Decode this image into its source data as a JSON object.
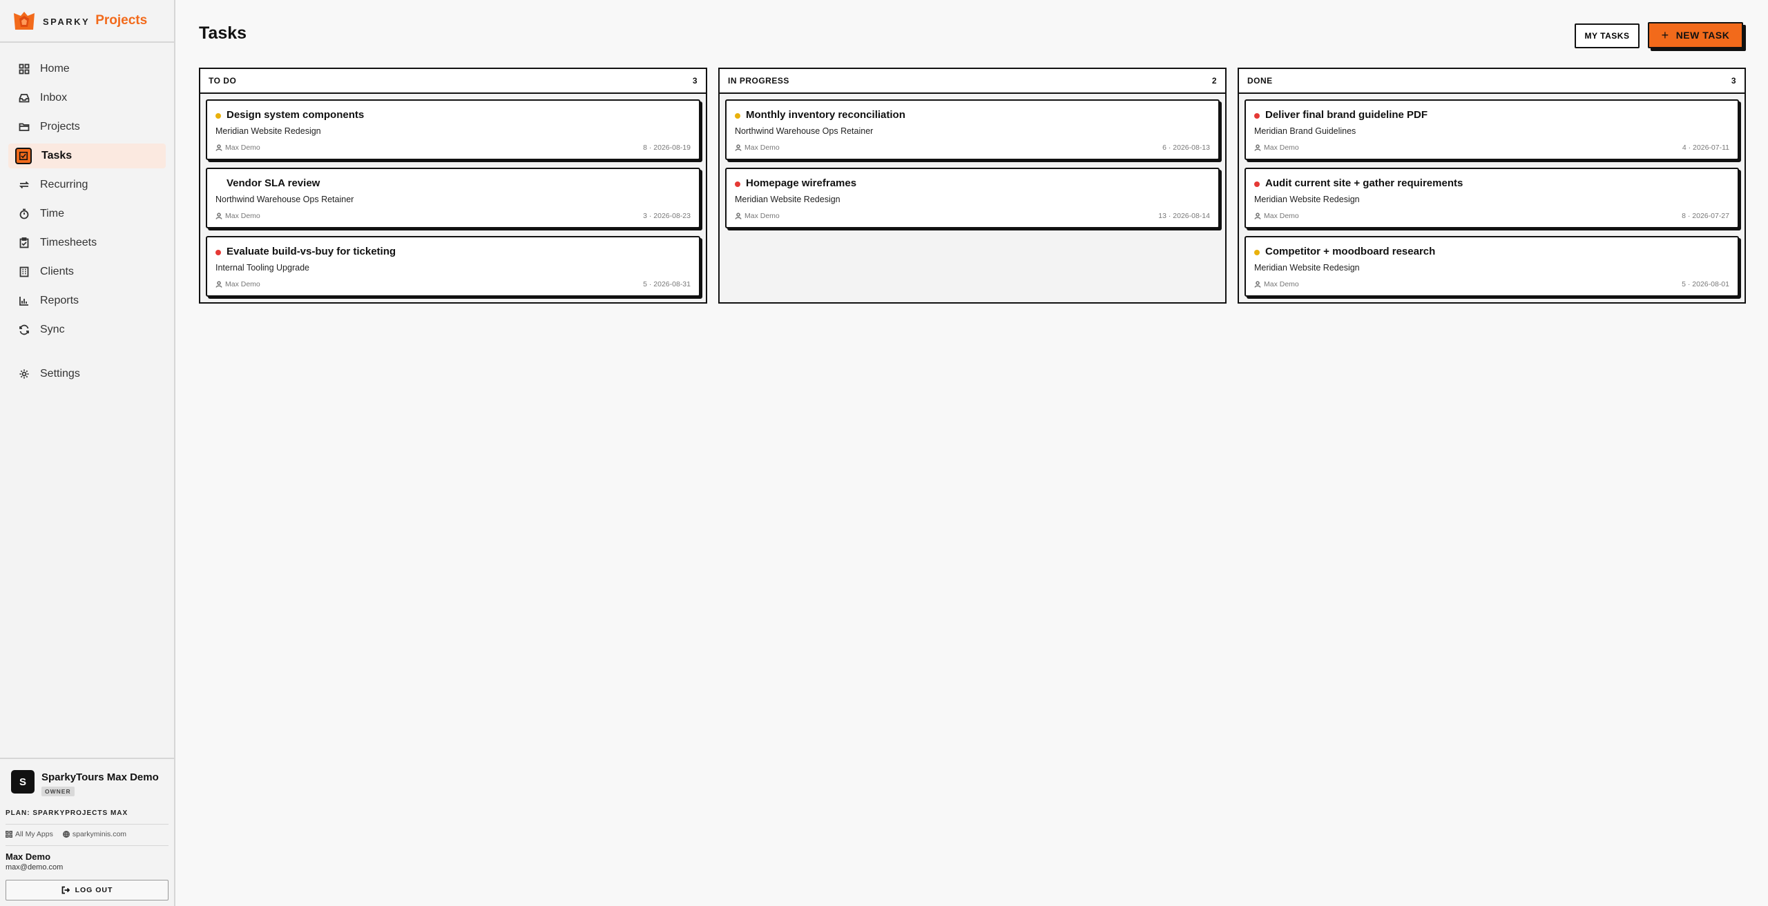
{
  "brand": {
    "sparky": "SPARKY",
    "product": "Projects"
  },
  "colors": {
    "accent": "#f26a1b",
    "priority_medium": "#e9b10c",
    "priority_high": "#e53935",
    "active_nav_bg": "#fbe9e0"
  },
  "nav": [
    {
      "label": "Home",
      "icon": "home-grid-icon",
      "active": false
    },
    {
      "label": "Inbox",
      "icon": "inbox-icon",
      "active": false
    },
    {
      "label": "Projects",
      "icon": "folder-icon",
      "active": false
    },
    {
      "label": "Tasks",
      "icon": "checkbox-icon",
      "active": true
    },
    {
      "label": "Recurring",
      "icon": "repeat-icon",
      "active": false
    },
    {
      "label": "Time",
      "icon": "timer-icon",
      "active": false
    },
    {
      "label": "Timesheets",
      "icon": "clipboard-icon",
      "active": false
    },
    {
      "label": "Clients",
      "icon": "building-icon",
      "active": false
    },
    {
      "label": "Reports",
      "icon": "bar-chart-icon",
      "active": false
    },
    {
      "label": "Sync",
      "icon": "refresh-icon",
      "active": false
    }
  ],
  "settings": {
    "label": "Settings",
    "icon": "gear-icon"
  },
  "workspace": {
    "initial": "S",
    "name": "SparkyTours Max Demo",
    "role": "OWNER"
  },
  "plan": "PLAN: SPARKYPROJECTS MAX",
  "links": {
    "all_apps": "All My Apps",
    "site": "sparkyminis.com"
  },
  "user": {
    "name": "Max Demo",
    "email": "max@demo.com"
  },
  "logout_label": "LOG OUT",
  "header": {
    "title": "Tasks",
    "my_tasks": "MY TASKS",
    "new_task": "NEW TASK"
  },
  "columns": [
    {
      "name": "TO DO",
      "count": "3",
      "cards": [
        {
          "title": "Design system components",
          "project": "Meridian Website Redesign",
          "assignee": "Max Demo",
          "meta": "8 · 2026-08-19",
          "priority": "yellow"
        },
        {
          "title": "Vendor SLA review",
          "project": "Northwind Warehouse Ops Retainer",
          "assignee": "Max Demo",
          "meta": "3 · 2026-08-23",
          "priority": "none"
        },
        {
          "title": "Evaluate build-vs-buy for ticketing",
          "project": "Internal Tooling Upgrade",
          "assignee": "Max Demo",
          "meta": "5 · 2026-08-31",
          "priority": "red"
        }
      ]
    },
    {
      "name": "IN PROGRESS",
      "count": "2",
      "cards": [
        {
          "title": "Monthly inventory reconciliation",
          "project": "Northwind Warehouse Ops Retainer",
          "assignee": "Max Demo",
          "meta": "6 · 2026-08-13",
          "priority": "yellow"
        },
        {
          "title": "Homepage wireframes",
          "project": "Meridian Website Redesign",
          "assignee": "Max Demo",
          "meta": "13 · 2026-08-14",
          "priority": "red"
        }
      ]
    },
    {
      "name": "DONE",
      "count": "3",
      "cards": [
        {
          "title": "Deliver final brand guideline PDF",
          "project": "Meridian Brand Guidelines",
          "assignee": "Max Demo",
          "meta": "4 · 2026-07-11",
          "priority": "red"
        },
        {
          "title": "Audit current site + gather requirements",
          "project": "Meridian Website Redesign",
          "assignee": "Max Demo",
          "meta": "8 · 2026-07-27",
          "priority": "red"
        },
        {
          "title": "Competitor + moodboard research",
          "project": "Meridian Website Redesign",
          "assignee": "Max Demo",
          "meta": "5 · 2026-08-01",
          "priority": "yellow"
        }
      ]
    }
  ]
}
